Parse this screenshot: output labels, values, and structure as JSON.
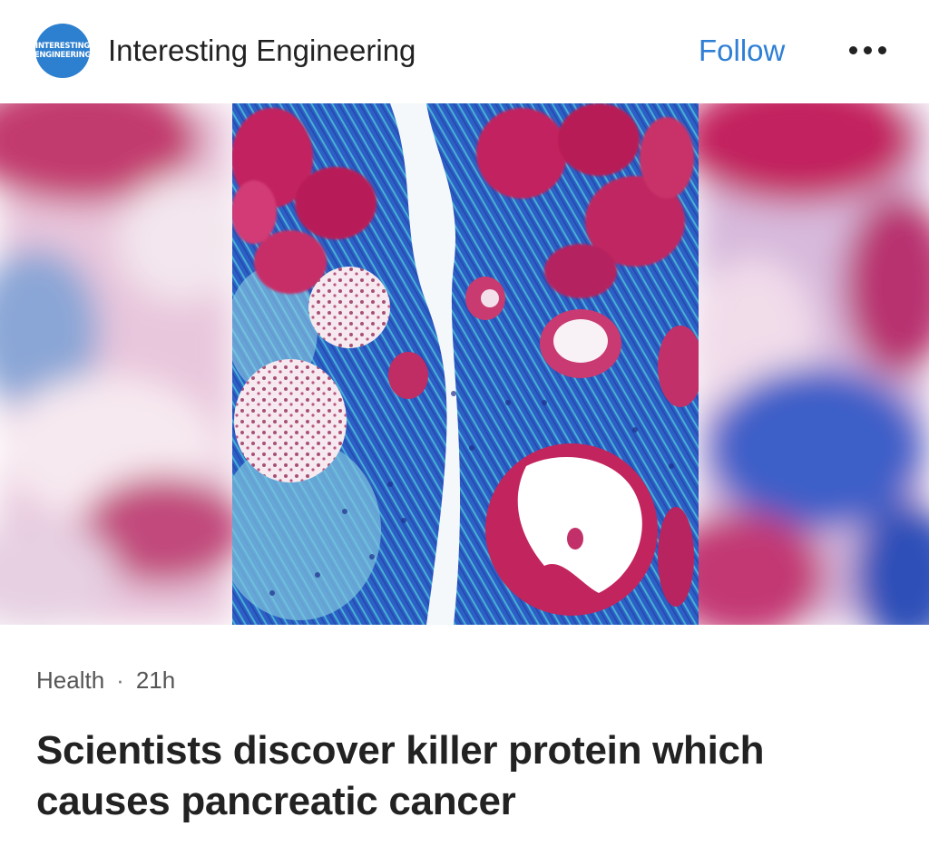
{
  "header": {
    "logo_line1": "INTERESTING",
    "logo_line2": "ENGINEERING",
    "publisher_name": "Interesting Engineering",
    "follow_label": "Follow",
    "more_icon": "more-horizontal-icon"
  },
  "article": {
    "image_subject": "microscopy-tissue-image",
    "category": "Health",
    "separator": "·",
    "age": "21h",
    "headline": "Scientists discover killer protein which causes pancreatic cancer"
  },
  "colors": {
    "accent": "#2e7fd6",
    "logo_bg": "#2d7fcf",
    "text": "#222222",
    "meta": "#555555",
    "stain_pink": "#c2245e",
    "stain_blue": "#2c5fc9",
    "stain_cyan": "#35a3c4"
  }
}
